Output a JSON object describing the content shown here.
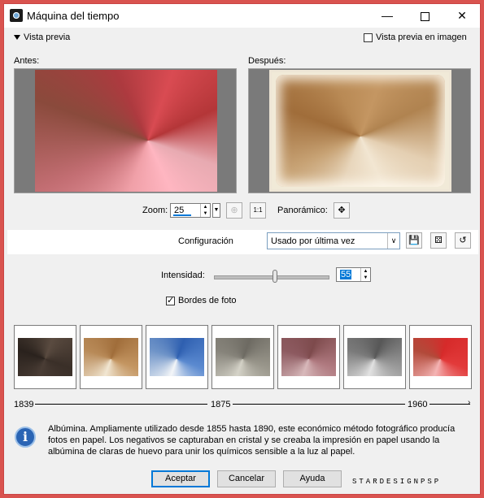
{
  "window": {
    "title": "Máquina del tiempo"
  },
  "preview": {
    "toggle_label": "Vista previa",
    "image_preview_label": "Vista previa en imagen",
    "image_preview_checked": false
  },
  "panes": {
    "before_label": "Antes:",
    "after_label": "Después:"
  },
  "zoom": {
    "label": "Zoom:",
    "value": "25",
    "fit_label": "1:1",
    "pan_label": "Panorámico:"
  },
  "config": {
    "label": "Configuración",
    "selected": "Usado por última vez"
  },
  "intensity": {
    "label": "Intensidad:",
    "value": "55",
    "level": 0.55
  },
  "photo_edges": {
    "label": "Bordes de foto",
    "checked": true
  },
  "timeline": {
    "start": "1839",
    "mid": "1875",
    "end": "1960"
  },
  "info": {
    "text": "Albúmina. Ampliamente utilizado desde 1855 hasta 1890, este económico método fotográfico producía fotos en papel. Los negativos se capturaban en cristal y se creaba la impresión en papel usando la albúmina de claras de huevo para unir los químicos sensible a la luz al papel."
  },
  "buttons": {
    "ok": "Aceptar",
    "cancel": "Cancelar",
    "help": "Ayuda"
  },
  "watermark": "STARDESIGNPSP",
  "colors": {
    "accent": "#0078d7",
    "frame": "#d9534f"
  }
}
